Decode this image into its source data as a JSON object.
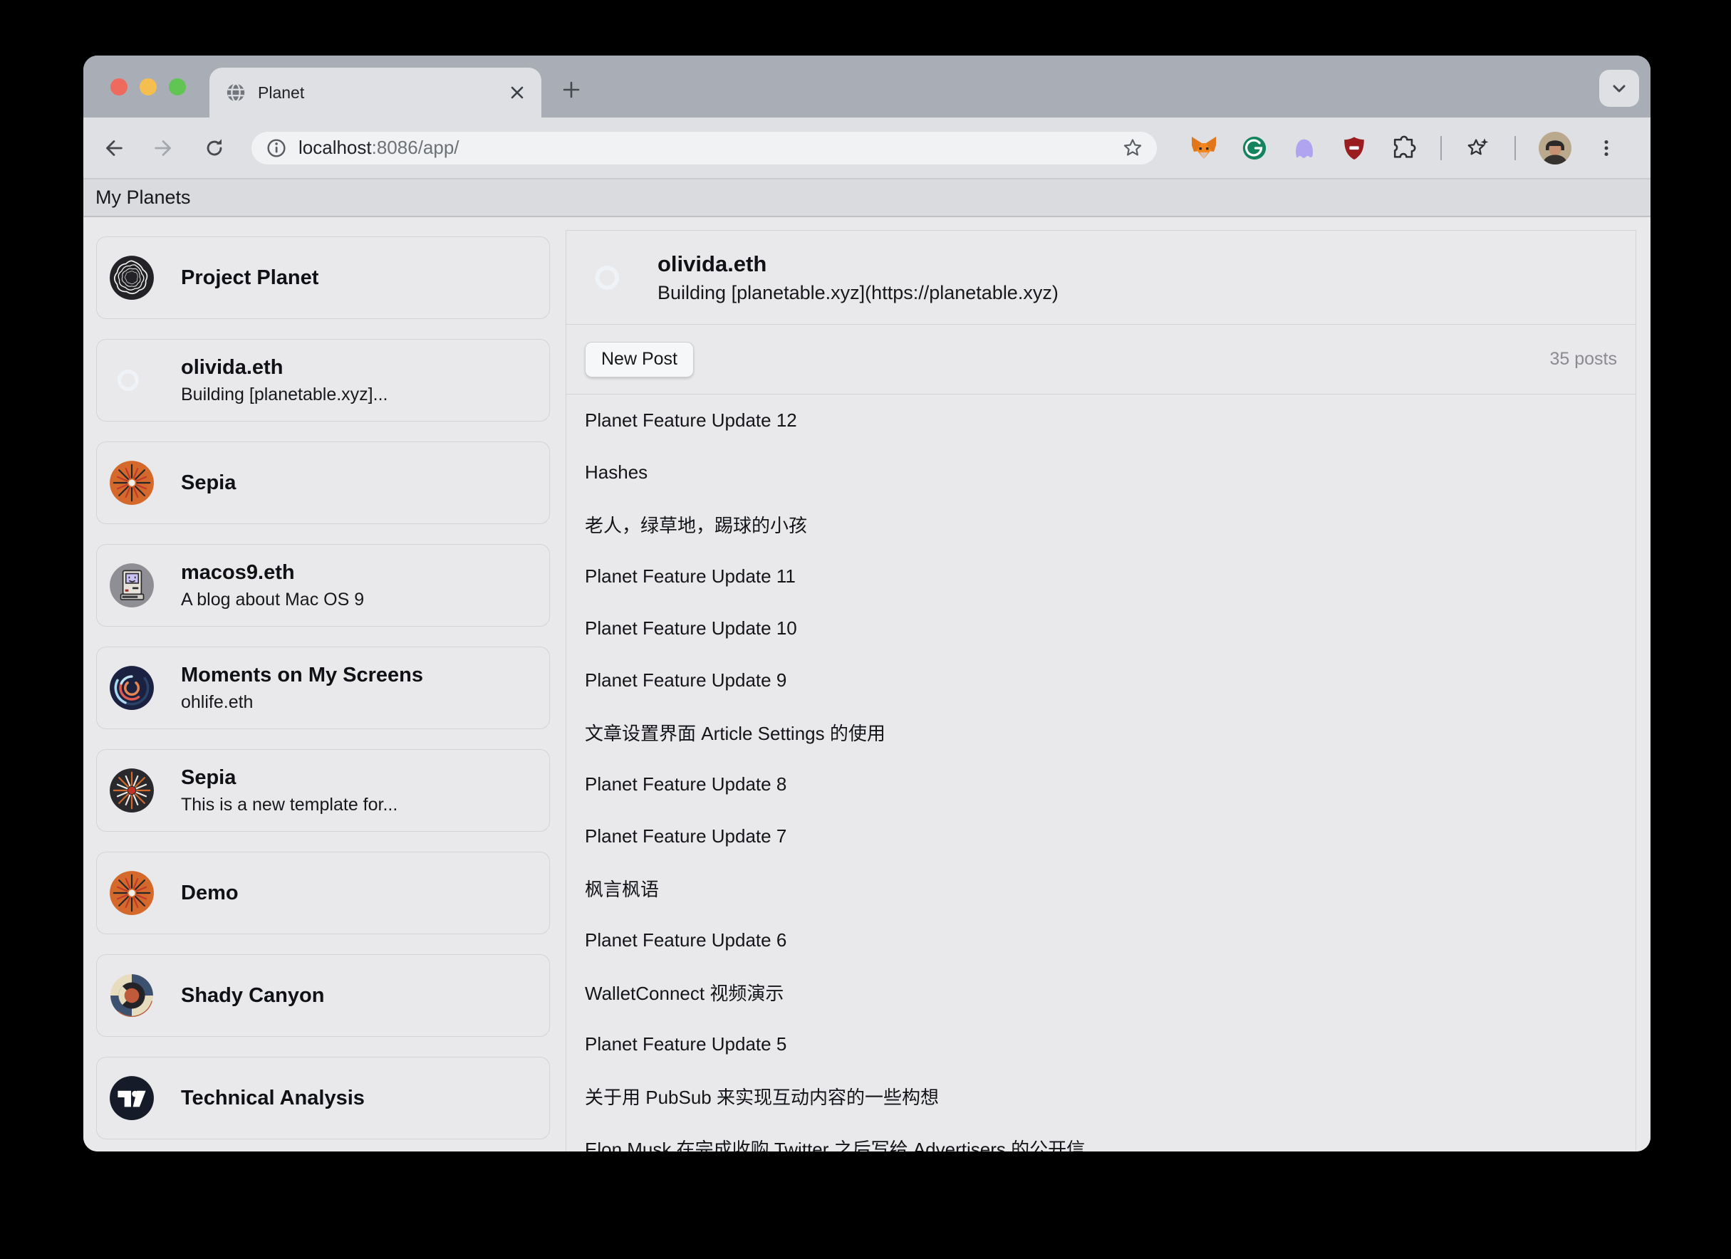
{
  "browser": {
    "tab_title": "Planet",
    "url_host": "localhost",
    "url_path": ":8086/app/",
    "page_header": "My Planets"
  },
  "sidebar": {
    "planets": [
      {
        "title": "Project Planet",
        "subtitle": "",
        "icon": "project-planet"
      },
      {
        "title": "olivida.eth",
        "subtitle": "Building [planetable.xyz]...",
        "icon": "olivida"
      },
      {
        "title": "Sepia",
        "subtitle": "",
        "icon": "sepia-orange"
      },
      {
        "title": "macos9.eth",
        "subtitle": "A blog about Mac OS 9",
        "icon": "macos9"
      },
      {
        "title": "Moments on My Screens",
        "subtitle": "ohlife.eth",
        "icon": "moments"
      },
      {
        "title": "Sepia",
        "subtitle": "This is a new template for...",
        "icon": "sepia-dark"
      },
      {
        "title": "Demo",
        "subtitle": "",
        "icon": "sepia-orange"
      },
      {
        "title": "Shady Canyon",
        "subtitle": "",
        "icon": "shady-canyon"
      },
      {
        "title": "Technical Analysis",
        "subtitle": "",
        "icon": "tradingview"
      }
    ]
  },
  "main": {
    "profile_name": "olivida.eth",
    "profile_bio": "Building [planetable.xyz](https://planetable.xyz)",
    "profile_icon": "olivida",
    "new_post_label": "New Post",
    "post_count": "35 posts",
    "posts": [
      "Planet Feature Update 12",
      "Hashes",
      "老人，绿草地，踢球的小孩",
      "Planet Feature Update 11",
      "Planet Feature Update 10",
      "Planet Feature Update 9",
      "文章设置界面 Article Settings 的使用",
      "Planet Feature Update 8",
      "Planet Feature Update 7",
      "枫言枫语",
      "Planet Feature Update 6",
      "WalletConnect 视频演示",
      "Planet Feature Update 5",
      "关于用 PubSub 来实现互动内容的一些构想",
      "Elon Musk 在完成收购 Twitter 之后写给 Advertisers 的公开信"
    ]
  },
  "colors": {
    "chrome_frame": "#A9ADB6",
    "chrome_toolbar": "#DEE0E3",
    "page_background": "#E9E9EB",
    "traffic_red": "#EE6A5F",
    "traffic_yellow": "#F5BF4F",
    "traffic_green": "#61C554"
  }
}
